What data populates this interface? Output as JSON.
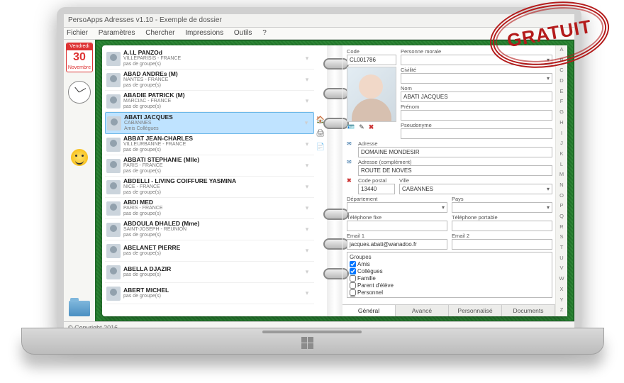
{
  "stamp_text": "GRATUIT",
  "window_title": "PersoApps Adresses v1.10 - Exemple de dossier",
  "menubar": [
    "Fichier",
    "Paramètres",
    "Chercher",
    "Impressions",
    "Outils",
    "?"
  ],
  "copyright": "© Copyright 2016",
  "calendar": {
    "dow": "Vendredi",
    "day": "30",
    "month": "Novembre"
  },
  "contacts": [
    {
      "name": "A.I.L PANZOd",
      "sub1": "VILLEPARISIS - FRANCE",
      "sub2": "pas de groupe(s)"
    },
    {
      "name": "ABAD ANDREs (M)",
      "sub1": "NANTES - FRANCE",
      "sub2": "pas de groupe(s)"
    },
    {
      "name": "ABADIE PATRICK (M)",
      "sub1": "MARCIAC - FRANCE",
      "sub2": "pas de groupe(s)"
    },
    {
      "name": "ABATI JACQUES",
      "sub1": "CABANNES",
      "sub2": "Amis   Collègues",
      "selected": true
    },
    {
      "name": "ABBAT JEAN-CHARLES",
      "sub1": "VILLEURBANNE - FRANCE",
      "sub2": "pas de groupe(s)"
    },
    {
      "name": "ABBATI STEPHANIE (Mlle)",
      "sub1": "PARIS - FRANCE",
      "sub2": "pas de groupe(s)"
    },
    {
      "name": "ABDELLI - LIVING COIFFURE YASMINA",
      "sub1": "NICE - FRANCE",
      "sub2": "pas de groupe(s)"
    },
    {
      "name": "ABDI MED",
      "sub1": "PARIS - FRANCE",
      "sub2": "pas de groupe(s)"
    },
    {
      "name": "ABDOULA DHALED (Mme)",
      "sub1": "SAINT-JOSEPH - REUNION",
      "sub2": "pas de groupe(s)"
    },
    {
      "name": "ABELANET PIERRE",
      "sub1": "",
      "sub2": "pas de groupe(s)"
    },
    {
      "name": "ABELLA DJAZIR",
      "sub1": "",
      "sub2": "pas de groupe(s)"
    },
    {
      "name": "ABERT MICHEL",
      "sub1": "",
      "sub2": "pas de groupe(s)"
    }
  ],
  "labels": {
    "code": "Code",
    "pers_morale": "Personne morale",
    "civilite": "Civilité",
    "nom": "Nom",
    "prenom": "Prénom",
    "pseudo": "Pseudonyme",
    "adresse": "Adresse",
    "adresse2": "Adresse (complément)",
    "cp": "Code postal",
    "ville": "Ville",
    "dept": "Département",
    "pays": "Pays",
    "tel_fixe": "Téléphone fixe",
    "tel_port": "Téléphone portable",
    "email1": "Email 1",
    "email2": "Email 2",
    "groupes": "Groupes"
  },
  "detail": {
    "code": "CL001786",
    "pers_morale": "",
    "civilite": "",
    "nom": "ABATI JACQUES",
    "prenom": "",
    "pseudo": "",
    "adresse": "DOMAINE MONDESIR",
    "adresse2": "ROUTE DE NOVES",
    "cp": "13440",
    "ville": "CABANNES",
    "dept": "",
    "pays": "",
    "tel_fixe": "",
    "tel_port": "",
    "email1": "jacques.abati@wanadoo.fr",
    "email2": ""
  },
  "groupes": [
    "Amis",
    "Collègues",
    "Famille",
    "Parent d'élève",
    "Personnel",
    "Professionnel"
  ],
  "groupes_checked": [
    true,
    true,
    false,
    false,
    false,
    false
  ],
  "detail_tabs": [
    "Général",
    "Avancé",
    "Personnalisé",
    "Documents"
  ],
  "az": [
    "A",
    "B",
    "C",
    "D",
    "E",
    "F",
    "G",
    "H",
    "I",
    "J",
    "K",
    "L",
    "M",
    "N",
    "O",
    "P",
    "Q",
    "R",
    "S",
    "T",
    "U",
    "V",
    "W",
    "X",
    "Y",
    "Z"
  ]
}
